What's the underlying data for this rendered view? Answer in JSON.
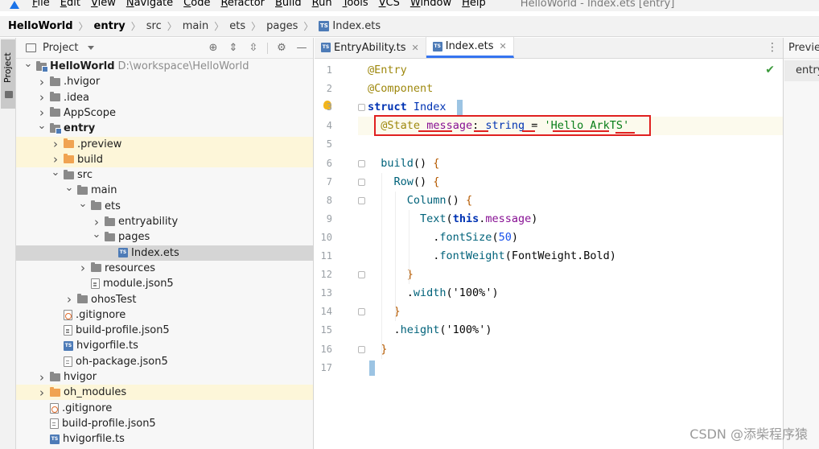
{
  "menu": {
    "items": [
      {
        "u": "F",
        "rest": "ile"
      },
      {
        "u": "E",
        "rest": "dit"
      },
      {
        "u": "V",
        "rest": "iew"
      },
      {
        "u": "N",
        "rest": "avigate"
      },
      {
        "u": "C",
        "rest": "ode"
      },
      {
        "u": "R",
        "rest": "efactor"
      },
      {
        "u": "B",
        "rest": "uild"
      },
      {
        "u": "R",
        "rest": "un"
      },
      {
        "u": "T",
        "rest": "ools"
      },
      {
        "u": "V",
        "rest": "CS"
      },
      {
        "u": "W",
        "rest": "indow"
      },
      {
        "u": "H",
        "rest": "elp"
      }
    ],
    "window_title": "HelloWorld - Index.ets [entry]"
  },
  "breadcrumb": [
    "HelloWorld",
    "entry",
    "src",
    "main",
    "ets",
    "pages",
    "Index.ets"
  ],
  "toolstrip": {
    "label": "Project"
  },
  "project_panel": {
    "title": "Project",
    "tree": [
      {
        "depth": 0,
        "chev": "v",
        "icon": "folder module",
        "name": "HelloWorld",
        "bold": true,
        "path": "D:\\workspace\\HelloWorld",
        "hl": ""
      },
      {
        "depth": 1,
        "chev": ">",
        "icon": "folder",
        "name": ".hvigor",
        "hl": ""
      },
      {
        "depth": 1,
        "chev": ">",
        "icon": "folder",
        "name": ".idea",
        "hl": ""
      },
      {
        "depth": 1,
        "chev": ">",
        "icon": "folder",
        "name": "AppScope",
        "hl": ""
      },
      {
        "depth": 1,
        "chev": "v",
        "icon": "folder module",
        "name": "entry",
        "bold": true,
        "hl": ""
      },
      {
        "depth": 2,
        "chev": ">",
        "icon": "folder orange",
        "name": ".preview",
        "hl": "yellow"
      },
      {
        "depth": 2,
        "chev": ">",
        "icon": "folder orange",
        "name": "build",
        "hl": "yellow"
      },
      {
        "depth": 2,
        "chev": "v",
        "icon": "folder",
        "name": "src",
        "hl": ""
      },
      {
        "depth": 3,
        "chev": "v",
        "icon": "folder",
        "name": "main",
        "hl": ""
      },
      {
        "depth": 4,
        "chev": "v",
        "icon": "folder",
        "name": "ets",
        "hl": ""
      },
      {
        "depth": 5,
        "chev": ">",
        "icon": "folder",
        "name": "entryability",
        "hl": ""
      },
      {
        "depth": 5,
        "chev": "v",
        "icon": "folder",
        "name": "pages",
        "hl": ""
      },
      {
        "depth": 6,
        "chev": "",
        "icon": "ts",
        "name": "Index.ets",
        "hl": "selected"
      },
      {
        "depth": 4,
        "chev": ">",
        "icon": "folder",
        "name": "resources",
        "hl": ""
      },
      {
        "depth": 4,
        "chev": "",
        "icon": "json",
        "name": "module.json5",
        "hl": ""
      },
      {
        "depth": 3,
        "chev": ">",
        "icon": "folder",
        "name": "ohosTest",
        "hl": ""
      },
      {
        "depth": 2,
        "chev": "",
        "icon": "gitignore",
        "name": ".gitignore",
        "hl": ""
      },
      {
        "depth": 2,
        "chev": "",
        "icon": "json",
        "name": "build-profile.json5",
        "hl": ""
      },
      {
        "depth": 2,
        "chev": "",
        "icon": "ts",
        "name": "hvigorfile.ts",
        "hl": ""
      },
      {
        "depth": 2,
        "chev": "",
        "icon": "json",
        "name": "oh-package.json5",
        "hl": ""
      },
      {
        "depth": 1,
        "chev": ">",
        "icon": "folder",
        "name": "hvigor",
        "hl": ""
      },
      {
        "depth": 1,
        "chev": ">",
        "icon": "folder orange",
        "name": "oh_modules",
        "hl": "yellow"
      },
      {
        "depth": 1,
        "chev": "",
        "icon": "gitignore",
        "name": ".gitignore",
        "hl": ""
      },
      {
        "depth": 1,
        "chev": "",
        "icon": "json",
        "name": "build-profile.json5",
        "hl": ""
      },
      {
        "depth": 1,
        "chev": "",
        "icon": "ts",
        "name": "hvigorfile.ts",
        "hl": ""
      }
    ]
  },
  "editor": {
    "tabs": [
      {
        "label": "EntryAbility.ts",
        "active": false
      },
      {
        "label": "Index.ets",
        "active": true
      }
    ],
    "lines": [
      [
        [
          "k-ann",
          "@Entry"
        ]
      ],
      [
        [
          "k-ann",
          "@Component"
        ]
      ],
      [
        [
          "k-kw",
          "struct"
        ],
        [
          "k-plain",
          " "
        ],
        [
          "k-cls",
          "Index"
        ],
        [
          "k-plain",
          " "
        ]
      ],
      [
        [
          "k-plain",
          "  "
        ],
        [
          "k-ann",
          "@State"
        ],
        [
          "k-plain",
          " "
        ],
        [
          "k-prop",
          "message"
        ],
        [
          "k-plain",
          ": "
        ],
        [
          "k-typ",
          "string"
        ],
        [
          "k-plain",
          " = "
        ],
        [
          "k-str",
          "'Hello ArkTS'"
        ]
      ],
      [],
      [
        [
          "k-plain",
          "  "
        ],
        [
          "k-fn",
          "build"
        ],
        [
          "k-plain",
          "() "
        ],
        [
          "k-brace",
          "{"
        ]
      ],
      [
        [
          "k-plain",
          "    "
        ],
        [
          "k-fn",
          "Row"
        ],
        [
          "k-plain",
          "() "
        ],
        [
          "k-brace",
          "{"
        ]
      ],
      [
        [
          "k-plain",
          "      "
        ],
        [
          "k-fn",
          "Column"
        ],
        [
          "k-plain",
          "() "
        ],
        [
          "k-brace",
          "{"
        ]
      ],
      [
        [
          "k-plain",
          "        "
        ],
        [
          "k-fn",
          "Text"
        ],
        [
          "k-plain",
          "("
        ],
        [
          "k-this",
          "this"
        ],
        [
          "k-plain",
          "."
        ],
        [
          "k-prop",
          "message"
        ],
        [
          "k-plain",
          ")"
        ]
      ],
      [
        [
          "k-plain",
          "          ."
        ],
        [
          "k-fn",
          "fontSize"
        ],
        [
          "k-plain",
          "("
        ],
        [
          "k-num",
          "50"
        ],
        [
          "k-plain",
          ")"
        ]
      ],
      [
        [
          "k-plain",
          "          ."
        ],
        [
          "k-fn",
          "fontWeight"
        ],
        [
          "k-plain",
          "(FontWeight.Bold)"
        ]
      ],
      [
        [
          "k-plain",
          "      "
        ],
        [
          "k-brace",
          "}"
        ]
      ],
      [
        [
          "k-plain",
          "      ."
        ],
        [
          "k-fn",
          "width"
        ],
        [
          "k-plain",
          "('100%')"
        ]
      ],
      [
        [
          "k-plain",
          "    "
        ],
        [
          "k-brace",
          "}"
        ]
      ],
      [
        [
          "k-plain",
          "    ."
        ],
        [
          "k-fn",
          "height"
        ],
        [
          "k-plain",
          "('100%')"
        ]
      ],
      [
        [
          "k-plain",
          "  "
        ],
        [
          "k-brace",
          "}"
        ]
      ],
      []
    ]
  },
  "preview": {
    "title": "Previewer",
    "entry": "entry"
  },
  "watermark": "CSDN @添柴程序猿"
}
